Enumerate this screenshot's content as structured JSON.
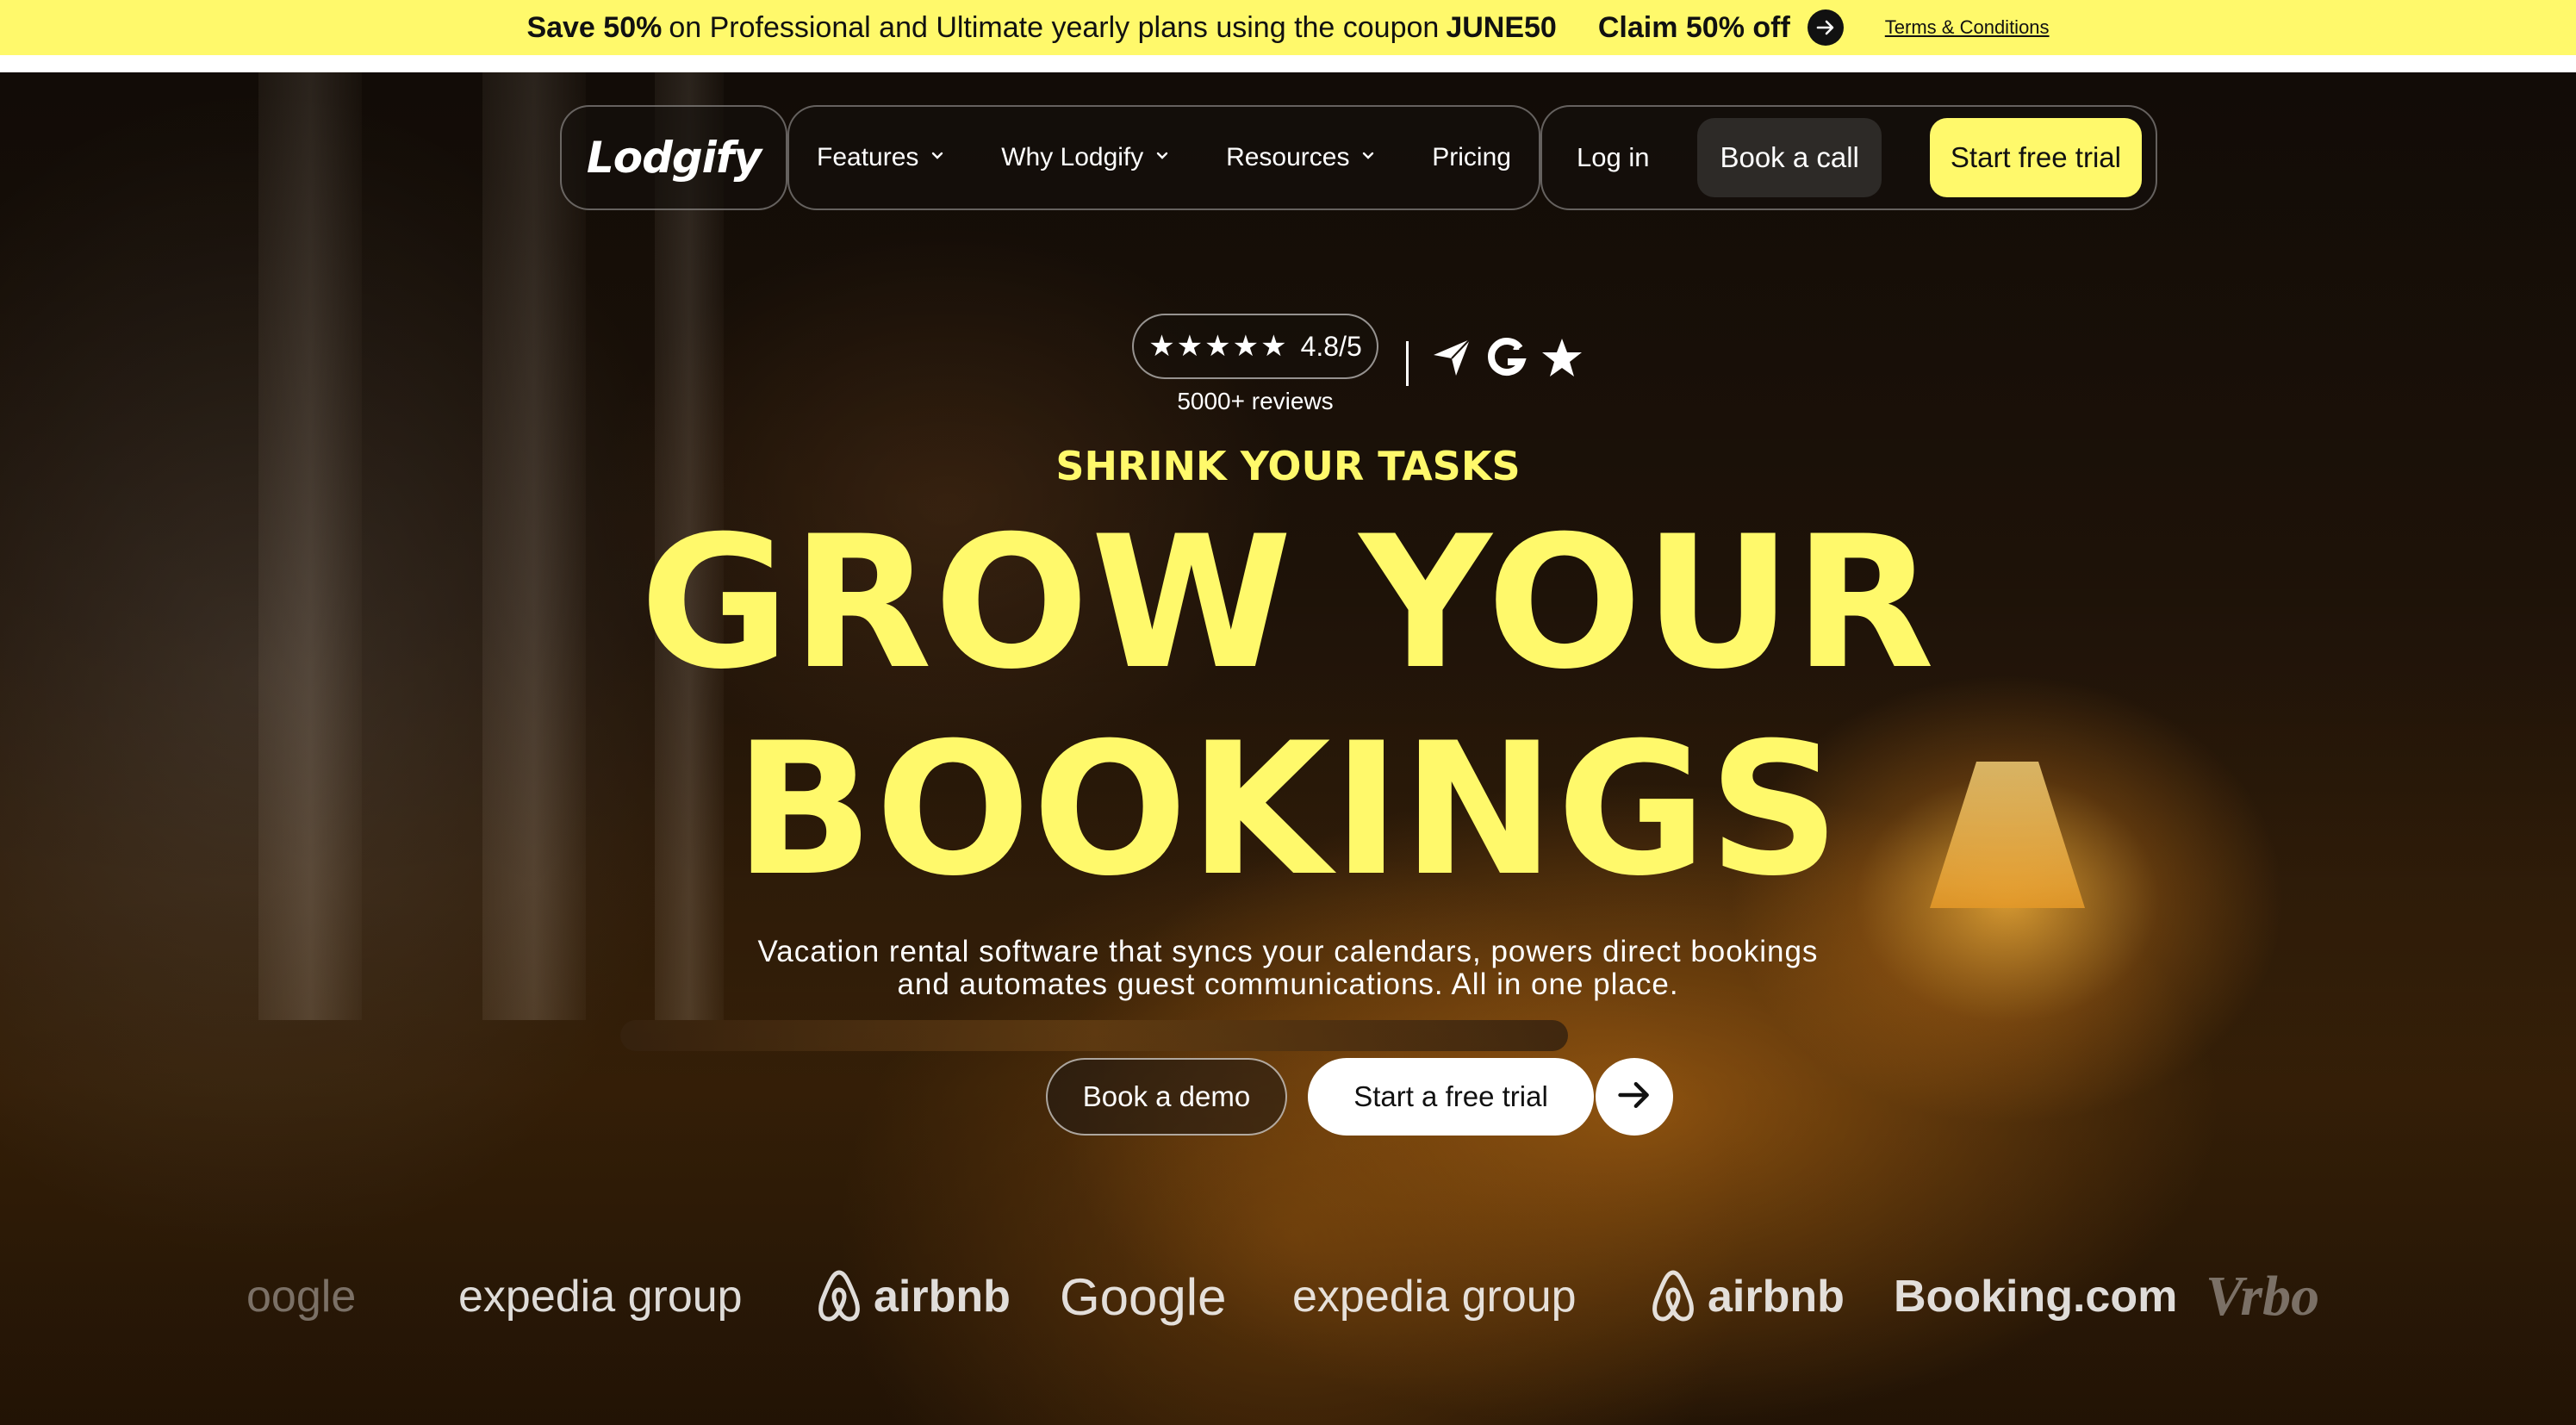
{
  "promo": {
    "save_text": "Save 50%",
    "middle_text": "on Professional and Ultimate yearly plans using the coupon",
    "coupon": "JUNE50",
    "claim_label": "Claim 50% off",
    "terms_label": "Terms & Conditions",
    "background_color": "#fff96b"
  },
  "nav": {
    "logo": "Lodgify",
    "menu": [
      {
        "label": "Features",
        "has_dropdown": true
      },
      {
        "label": "Why Lodgify",
        "has_dropdown": true
      },
      {
        "label": "Resources",
        "has_dropdown": true
      },
      {
        "label": "Pricing",
        "has_dropdown": false
      }
    ],
    "login_label": "Log in",
    "book_call_label": "Book a call",
    "start_trial_label": "Start free trial"
  },
  "rating": {
    "stars": "★★★★★",
    "score": "4.8/5",
    "reviews": "5000+ reviews",
    "platform_icons": [
      "capterra-icon",
      "g2-icon",
      "star-icon"
    ]
  },
  "hero": {
    "kicker": "SHRINK YOUR TASKS",
    "headline_line1": "GROW YOUR",
    "headline_line2": "BOOKINGS",
    "subtitle_line1": "Vacation rental software that syncs your calendars, powers direct bookings",
    "subtitle_line2": "and automates guest communications. All in one place.",
    "accent_color": "#fff96b"
  },
  "cta": {
    "demo_label": "Book a demo",
    "free_trial_label": "Start a free trial"
  },
  "partners": [
    {
      "label": "oogle",
      "partial": true
    },
    {
      "label": "expedia group",
      "partial": false
    },
    {
      "label": "airbnb",
      "partial": false
    },
    {
      "label": "Google",
      "partial": false
    },
    {
      "label": "expedia group",
      "partial": false
    },
    {
      "label": "airbnb",
      "partial": false
    },
    {
      "label": "Booking.com",
      "partial": false
    },
    {
      "label": "Vrbo",
      "partial": false
    }
  ]
}
